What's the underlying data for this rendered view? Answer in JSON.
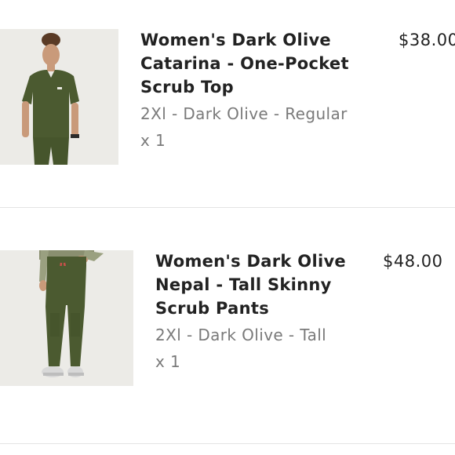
{
  "items": [
    {
      "name": "Women's Dark Olive Catarina - One-Pocket Scrub Top",
      "variant": "2Xl - Dark Olive - Regular",
      "quantity": "x 1",
      "price": "$38.00",
      "image_icon": "scrub-top-product-image"
    },
    {
      "name": "Women's Dark Olive Nepal - Tall Skinny Scrub Pants",
      "variant": "2Xl - Dark Olive - Tall",
      "quantity": "x 1",
      "price": "$48.00",
      "image_icon": "scrub-pants-product-image"
    }
  ],
  "colors": {
    "product_olive": "#4b5a30",
    "divider": "#e4e4e4",
    "text_primary": "#222222",
    "text_secondary": "#7a7a7a"
  }
}
